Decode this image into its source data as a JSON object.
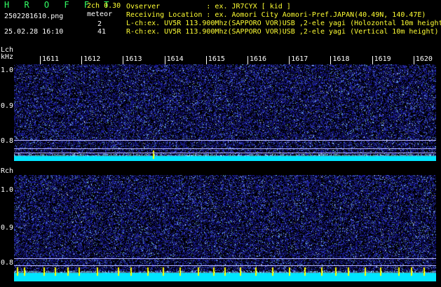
{
  "header": {
    "title": "H R O F F T",
    "filename": "2502281610.png",
    "datetime": "25.02.28 16:10",
    "ch_mode": "2ch 0.30",
    "meteor_label": "meteor",
    "meteor_lch": "2",
    "meteor_rch": "41",
    "observer": "Ovserver           : ex. JR7CYX [ kid ]",
    "location": "Receiving Location : ex. Aomori City Aomori-Pref.JAPAN(40.49N, 140.47E)",
    "lch_info": "L-ch:ex. UV5R 113.900Mhz(SAPPORO VOR)USB ,2-ele yagi (Holozontal 10m height)",
    "rch_info": "R-ch:ex. UV5R 113.900Mhz(SAPPORO VOR)USB ,2-ele yagi (Vertical 10m height)"
  },
  "lch": {
    "label": "Lch",
    "unit": "kHz",
    "ticks": [
      "1.0",
      "0.9",
      "0.8"
    ]
  },
  "rch": {
    "label": "Rch",
    "ticks": [
      "1.0",
      "0.9",
      "0.8"
    ]
  },
  "time_axis": [
    "1611",
    "1612",
    "1613",
    "1614",
    "1615",
    "1616",
    "1617",
    "1618",
    "1619",
    "1620"
  ],
  "colors": {
    "background": "#000000",
    "noise_dark": "#1a1a8c",
    "baseline": "#00e5ff",
    "meteor": "#ffff00",
    "header_yellow": "#ffff33",
    "header_green": "#33ff66"
  }
}
